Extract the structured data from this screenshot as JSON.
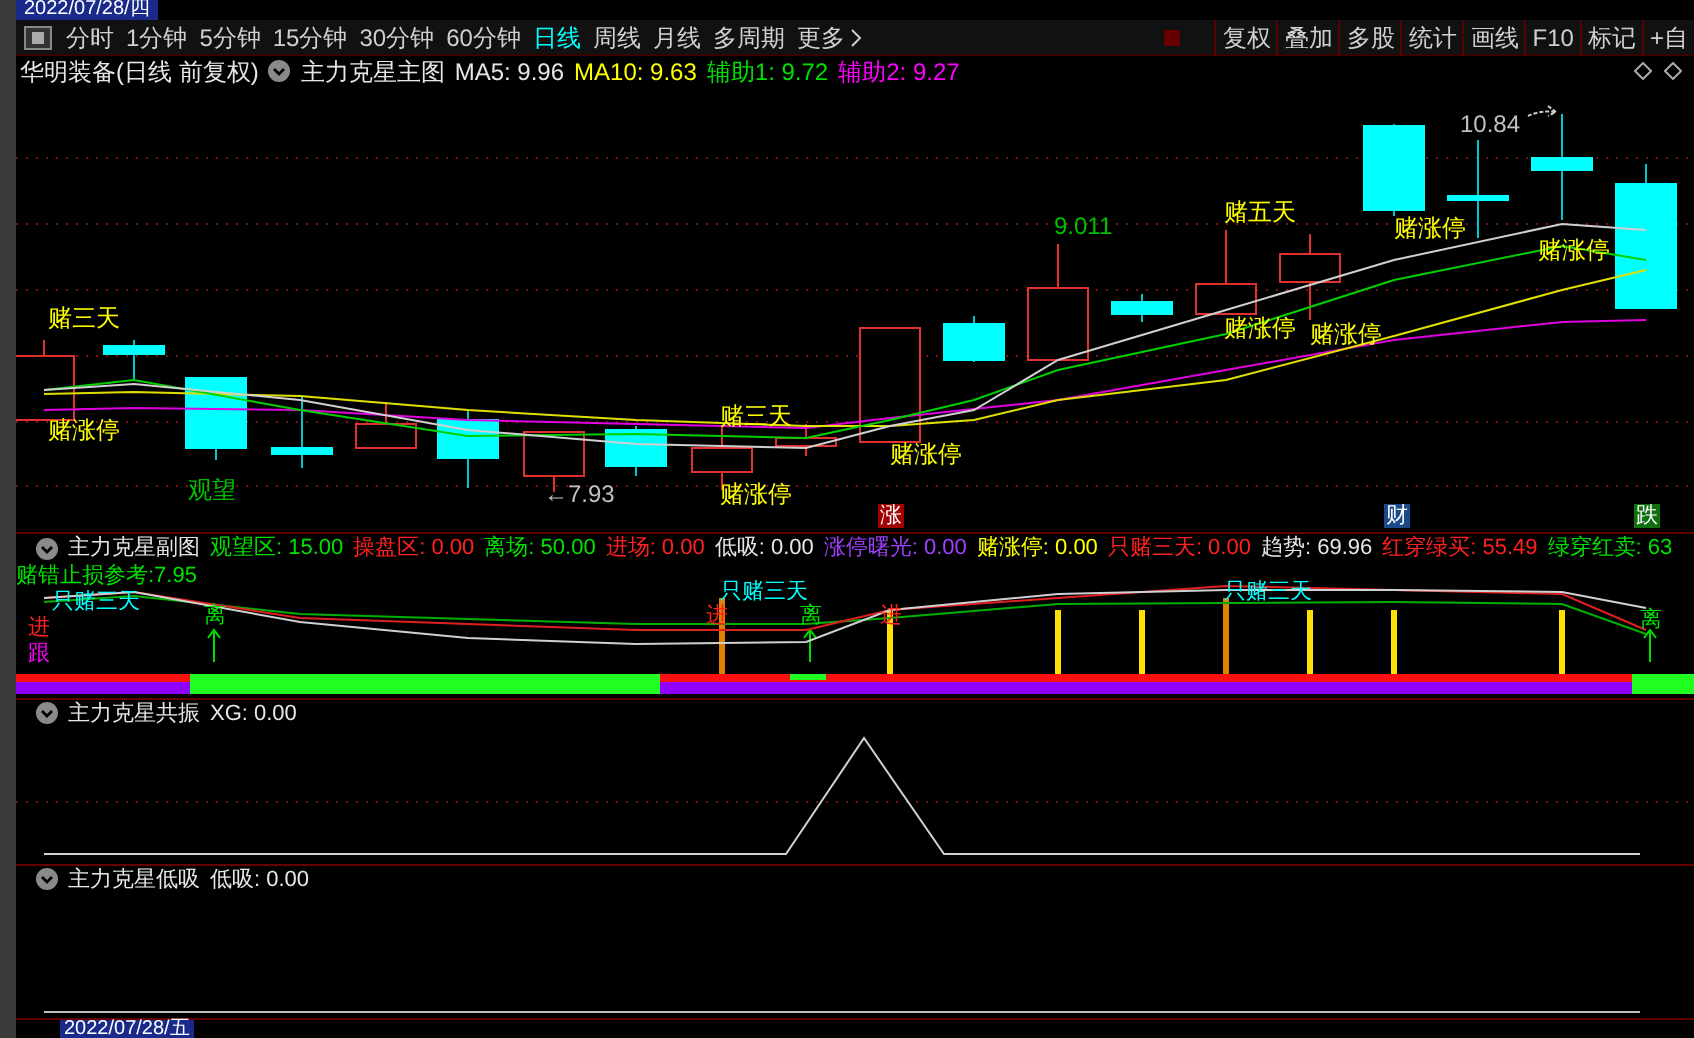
{
  "date_top": "2022/07/28/四",
  "toolbar": {
    "periods": [
      {
        "label": "分时",
        "selected": false
      },
      {
        "label": "1分钟",
        "selected": false
      },
      {
        "label": "5分钟",
        "selected": false
      },
      {
        "label": "15分钟",
        "selected": false
      },
      {
        "label": "30分钟",
        "selected": false
      },
      {
        "label": "60分钟",
        "selected": false
      },
      {
        "label": "日线",
        "selected": true
      },
      {
        "label": "周线",
        "selected": false
      },
      {
        "label": "月线",
        "selected": false
      },
      {
        "label": "多周期",
        "selected": false
      },
      {
        "label": "更多",
        "selected": false
      }
    ],
    "actions": [
      "复权",
      "叠加",
      "多股",
      "统计",
      "画线",
      "F10",
      "标记",
      "+自"
    ]
  },
  "main_header": {
    "stock": "华明装备(日线 前复权)",
    "indicator": "主力克星主图",
    "values": [
      {
        "text": "MA5: 9.96",
        "color": "#e6e6e6"
      },
      {
        "text": "MA10: 9.63",
        "color": "#ffff00"
      },
      {
        "text": "辅助1: 9.72",
        "color": "#00e000"
      },
      {
        "text": "辅助2: 9.27",
        "color": "#ff00ff"
      }
    ]
  },
  "main_chart": {
    "labels": [
      {
        "kind": "text",
        "text": "赌三天",
        "color": "#ffff00"
      },
      {
        "kind": "text",
        "text": "赌涨停",
        "color": "#ffff00"
      },
      {
        "kind": "text",
        "text": "观望",
        "color": "#00c000"
      },
      {
        "kind": "text",
        "text": "←7.93",
        "color": "#c0c0c0"
      },
      {
        "kind": "text",
        "text": "赌三天",
        "color": "#ffff00"
      },
      {
        "kind": "text",
        "text": "赌涨停",
        "color": "#ffff00"
      },
      {
        "kind": "text",
        "text": "赌涨停",
        "color": "#ffff00"
      },
      {
        "kind": "text",
        "text": "9.011",
        "color": "#00c000"
      },
      {
        "kind": "text",
        "text": "赌五天",
        "color": "#ffff00"
      },
      {
        "kind": "text",
        "text": "赌涨停",
        "color": "#ffff00"
      },
      {
        "kind": "text",
        "text": "赌涨停",
        "color": "#ffff00"
      },
      {
        "kind": "text",
        "text": "赌涨停",
        "color": "#ffff00"
      },
      {
        "kind": "text",
        "text": "10.84",
        "color": "#c0c0c0"
      },
      {
        "kind": "text",
        "text": "赌涨停",
        "color": "#ffff00"
      },
      {
        "kind": "badge",
        "text": "涨",
        "color": "#a00000"
      },
      {
        "kind": "badge",
        "text": "财",
        "color": "#1a4a8a"
      },
      {
        "kind": "badge",
        "text": "跌",
        "color": "#107010"
      }
    ]
  },
  "sub_panel": {
    "title": "主力克星副图",
    "values": [
      {
        "text": "观望区: 15.00",
        "color": "#00e000"
      },
      {
        "text": "操盘区: 0.00",
        "color": "#ff2020"
      },
      {
        "text": "离场: 50.00",
        "color": "#00e000"
      },
      {
        "text": "进场: 0.00",
        "color": "#ff2020"
      },
      {
        "text": "低吸: 0.00",
        "color": "#e6e6e6"
      },
      {
        "text": "涨停曙光: 0.00",
        "color": "#a040ff"
      },
      {
        "text": "赌涨停: 0.00",
        "color": "#ffff00"
      },
      {
        "text": "只赌三天: 0.00",
        "color": "#ff2020"
      },
      {
        "text": "趋势: 69.96",
        "color": "#e6e6e6"
      },
      {
        "text": "红穿绿买: 55.49",
        "color": "#ff2020"
      },
      {
        "text": "绿穿红卖: 63",
        "color": "#00e000"
      }
    ],
    "labels": [
      {
        "text": "赌错止损参考:7.95",
        "color": "#00e000"
      },
      {
        "text": "只赌三天",
        "color": "#00ffff"
      },
      {
        "text": "只赌三天",
        "color": "#00ffff"
      },
      {
        "text": "只赌三天",
        "color": "#00ffff"
      },
      {
        "text": "进",
        "color": "#ff2020"
      },
      {
        "text": "离",
        "color": "#00e000"
      },
      {
        "text": "进",
        "color": "#ff2020"
      },
      {
        "text": "离",
        "color": "#00e000"
      },
      {
        "text": "进",
        "color": "#ff2020"
      },
      {
        "text": "离",
        "color": "#00e000"
      },
      {
        "text": "跟",
        "color": "#ff00ff"
      }
    ]
  },
  "resonance_panel": {
    "title": "主力克星共振",
    "values": [
      {
        "text": "XG: 0.00",
        "color": "#e6e6e6"
      }
    ]
  },
  "low_panel": {
    "title": "主力克星低吸",
    "values": [
      {
        "text": "低吸: 0.00",
        "color": "#e6e6e6"
      }
    ]
  },
  "date_bottom": "2022/07/28/五"
}
